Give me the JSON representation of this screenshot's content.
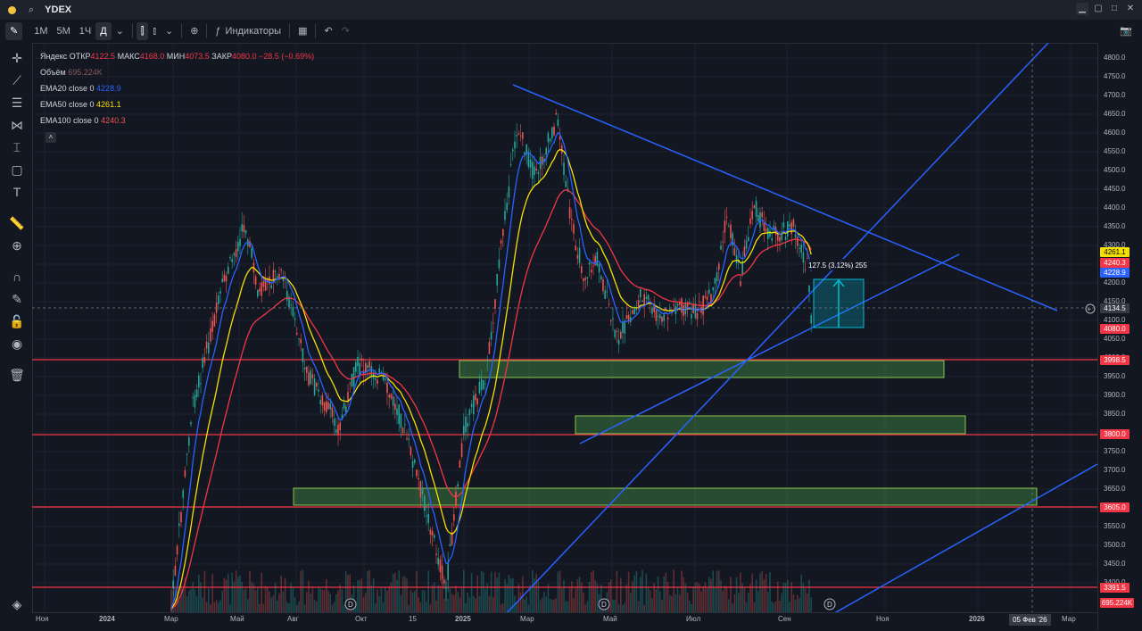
{
  "window": {
    "ticker": "YDEX"
  },
  "toolbar": {
    "intervals": [
      "1М",
      "5М",
      "1Ч",
      "Д"
    ],
    "indicators_label": "Индикаторы"
  },
  "legend": {
    "name": "Яндекс",
    "open_label": "ОТКР",
    "open": "4122.5",
    "high_label": "МАКС",
    "high": "4168.0",
    "low_label": "МИН",
    "low": "4073.5",
    "close_label": "ЗАКР",
    "close": "4080.0",
    "change": "−28.5 (−0.69%)",
    "volume_label": "Объём",
    "volume": "695.224K",
    "ema20_label": "EMA20 close 0",
    "ema20": "4228.9",
    "ema50_label": "EMA50 close 0",
    "ema50": "4261.1",
    "ema100_label": "EMA100 close 0",
    "ema100": "4240.3"
  },
  "measure": {
    "text": "127.5 (3.12%) 255"
  },
  "price_axis": {
    "ticks": [
      "4800.0",
      "4750.0",
      "4700.0",
      "4650.0",
      "4600.0",
      "4550.0",
      "4500.0",
      "4450.0",
      "4400.0",
      "4350.0",
      "4300.0",
      "4250.0",
      "4200.0",
      "4150.0",
      "4100.0",
      "4050.0",
      "4000.0",
      "3950.0",
      "3900.0",
      "3850.0",
      "3800.0",
      "3750.0",
      "3700.0",
      "3650.0",
      "3600.0",
      "3550.0",
      "3500.0",
      "3450.0",
      "3400.0"
    ],
    "tags": {
      "ema50": "4261.1",
      "ema100": "4240.3",
      "ema20": "4228.9",
      "crosshair": "4134.5",
      "last": "4080.0",
      "level1": "3998.5",
      "level2": "3800.0",
      "level3": "3605.0",
      "level4": "3391.5",
      "volume": "695.224K"
    }
  },
  "time_axis": {
    "labels": [
      "Ноя",
      "2024",
      "Мар",
      "Май",
      "Авг",
      "Окт",
      "15",
      "2025",
      "Мар",
      "Май",
      "Июл",
      "Сен",
      "Ноя",
      "2026",
      "Мар"
    ],
    "crosshair_date": "05 Фев '26",
    "dividend_marker": "D"
  },
  "colors": {
    "up": "#26a69a",
    "down": "#ef5350",
    "ema20": "#2962ff",
    "ema50": "#f5e100",
    "ema100": "#f23645",
    "trend": "#2962ff",
    "zone": "#4caf50"
  }
}
